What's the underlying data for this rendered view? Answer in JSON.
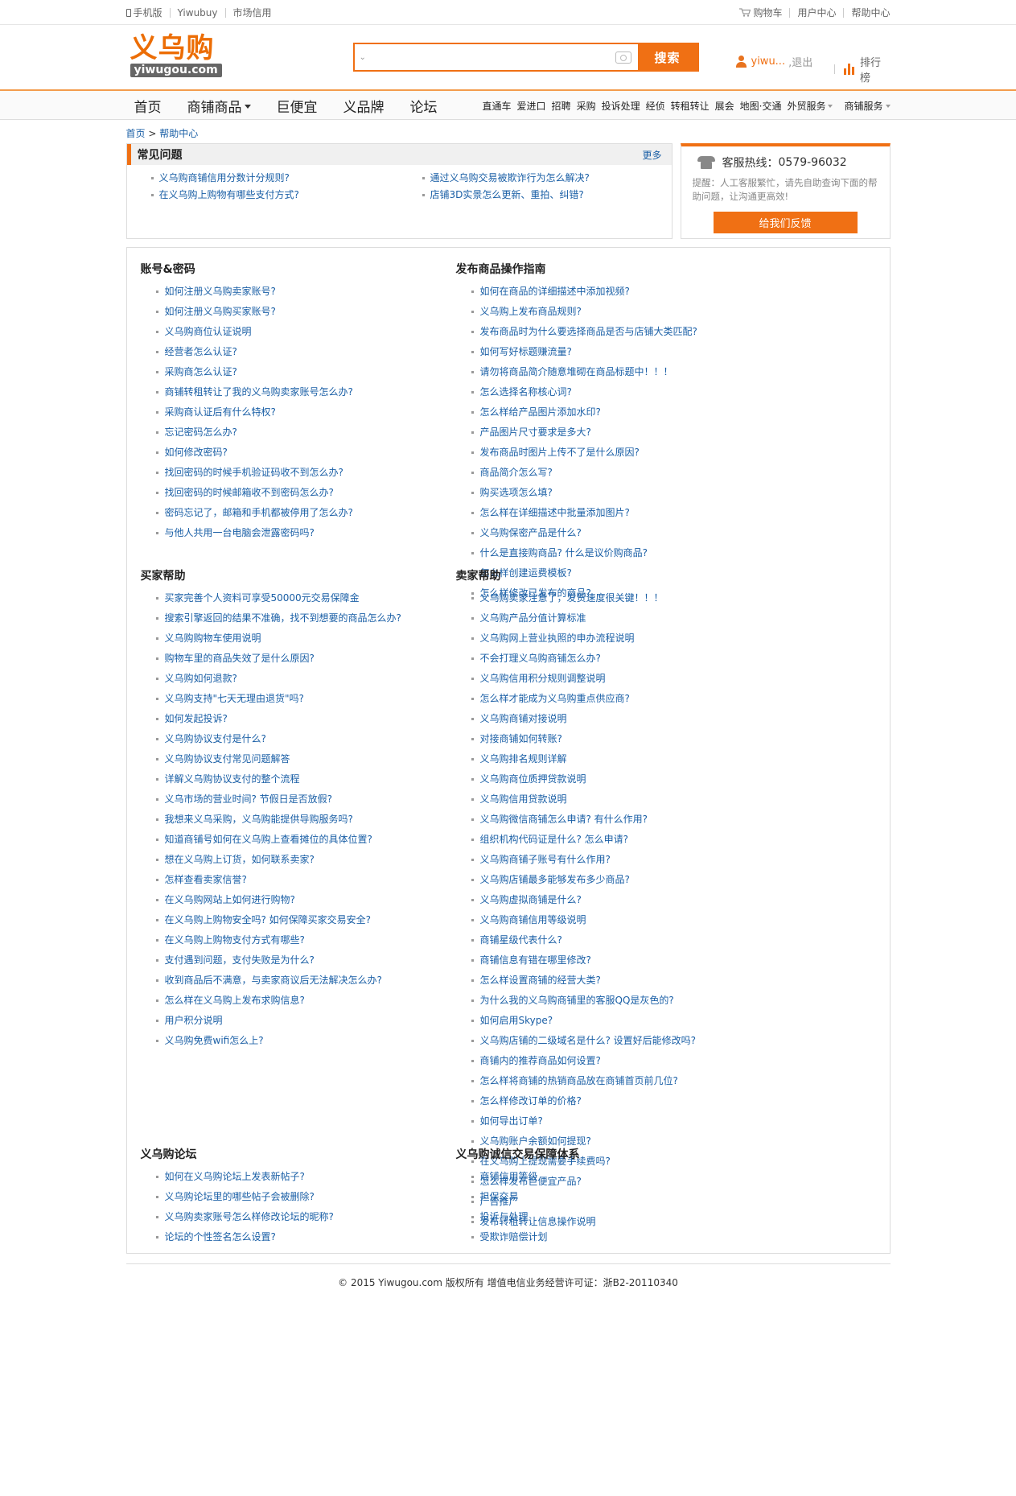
{
  "topbar": {
    "left": [
      "手机版",
      "Yiwubuy",
      "市场信用"
    ],
    "right": [
      "购物车",
      "用户中心",
      "帮助中心"
    ]
  },
  "logo": {
    "cn": "义乌购",
    "en": "yiwugou.com"
  },
  "search": {
    "button": "搜索",
    "placeholder": ""
  },
  "user": {
    "name": "yiwu...",
    "logout": "退出",
    "rank": "排行榜"
  },
  "nav": {
    "main": [
      "首页",
      "商铺商品",
      "巨便宜",
      "义品牌",
      "论坛"
    ],
    "sub": [
      "直通车",
      "爱进口",
      "招聘",
      "采购",
      "投诉处理",
      "经侦",
      "转租转让",
      "展会",
      "地图·交通",
      "外贸服务",
      "商铺服务"
    ]
  },
  "breadcrumb": {
    "home": "首页",
    "sep": ">",
    "current": "帮助中心"
  },
  "faq": {
    "title": "常见问题",
    "more": "更多",
    "items": [
      "义乌购商铺信用分数计分规则?",
      "通过义乌购交易被欺诈行为怎么解决?",
      "在义乌购上购物有哪些支付方式?",
      "店铺3D实景怎么更新、重拍、纠错?"
    ]
  },
  "hotline": {
    "label": "客服热线：",
    "number": "0579-96032",
    "tip": "提醒：人工客服繁忙，请先自助查询下面的帮助问题，让沟通更高效!",
    "feedback": "给我们反馈"
  },
  "sections": {
    "account": {
      "title": "账号&密码",
      "items": [
        "如何注册义乌购卖家账号?",
        "如何注册义乌购买家账号?",
        "义乌购商位认证说明",
        "经营者怎么认证?",
        "采购商怎么认证?",
        "商铺转租转让了我的义乌购卖家账号怎么办?",
        "采购商认证后有什么特权?",
        "忘记密码怎么办?",
        "如何修改密码?",
        "找回密码的时候手机验证码收不到怎么办?",
        "找回密码的时候邮箱收不到密码怎么办?",
        "密码忘记了，邮箱和手机都被停用了怎么办?",
        "与他人共用一台电脑会泄露密码吗?"
      ]
    },
    "publish": {
      "title": "发布商品操作指南",
      "items": [
        "如何在商品的详细描述中添加视频?",
        "义乌购上发布商品规则?",
        "发布商品时为什么要选择商品是否与店铺大类匹配?",
        "如何写好标题赚流量?",
        "请勿将商品简介随意堆砌在商品标题中！！！",
        "怎么选择名称核心词?",
        "怎么样给产品图片添加水印?",
        "产品图片尺寸要求是多大?",
        "发布商品时图片上传不了是什么原因?",
        "商品简介怎么写?",
        "购买选项怎么填?",
        "怎么样在详细描述中批量添加图片?",
        "义乌购保密产品是什么?",
        "什么是直接购商品? 什么是议价购商品?",
        "怎么样创建运费模板?",
        "怎么样修改已发布的商品?"
      ]
    },
    "buyer": {
      "title": "买家帮助",
      "items": [
        "买家完善个人资料可享受50000元交易保障金",
        "搜索引擎返回的结果不准确，找不到想要的商品怎么办?",
        "义乌购购物车使用说明",
        "购物车里的商品失效了是什么原因?",
        "义乌购如何退款?",
        "义乌购支持\"七天无理由退货\"吗?",
        "如何发起投诉?",
        "义乌购协议支付是什么?",
        "义乌购协议支付常见问题解答",
        "详解义乌购协议支付的整个流程",
        "义乌市场的营业时间? 节假日是否放假?",
        "我想来义乌采购，义乌购能提供导购服务吗?",
        "知道商铺号如何在义乌购上查看摊位的具体位置?",
        "想在义乌购上订货，如何联系卖家?",
        "怎样查看卖家信誉?",
        "在义乌购网站上如何进行购物?",
        "在义乌购上购物安全吗? 如何保障买家交易安全?",
        "在义乌购上购物支付方式有哪些?",
        "支付遇到问题，支付失败是为什么?",
        "收到商品后不满意，与卖家商议后无法解决怎么办?",
        "怎么样在义乌购上发布求购信息?",
        "用户积分说明",
        "义乌购免费wifi怎么上?"
      ]
    },
    "seller": {
      "title": "卖家帮助",
      "items": [
        "义乌购卖家注意了，发货速度很关键！！！",
        "义乌购产品分值计算标准",
        "义乌购网上营业执照的申办流程说明",
        "不会打理义乌购商铺怎么办?",
        "义乌购信用积分规则调整说明",
        "怎么样才能成为义乌购重点供应商?",
        "义乌购商铺对接说明",
        "对接商铺如何转账?",
        "义乌购排名规则详解",
        "义乌购商位质押贷款说明",
        "义乌购信用贷款说明",
        "义乌购微信商铺怎么申请? 有什么作用?",
        "组织机构代码证是什么? 怎么申请?",
        "义乌购商铺子账号有什么作用?",
        "义乌购店铺最多能够发布多少商品?",
        "义乌购虚拟商铺是什么?",
        "义乌购商铺信用等级说明",
        "商铺星级代表什么?",
        "商铺信息有错在哪里修改?",
        "怎么样设置商铺的经营大类?",
        "为什么我的义乌购商铺里的客服QQ是灰色的?",
        "如何启用Skype?",
        "义乌购店铺的二级域名是什么? 设置好后能修改吗?",
        "商铺内的推荐商品如何设置?",
        "怎么样将商铺的热销商品放在商铺首页前几位?",
        "怎么样修改订单的价格?",
        "如何导出订单?",
        "义乌购账户余额如何提现?",
        "在义乌购上提现需要手续费吗?",
        "怎么样发布巨便宜产品?",
        "广告推广",
        "发布转租转让信息操作说明"
      ]
    },
    "forum": {
      "title": "义乌购论坛",
      "items": [
        "如何在义乌购论坛上发表新帖子?",
        "义乌购论坛里的哪些帖子会被删除?",
        "义乌购卖家账号怎么样修改论坛的昵称?",
        "论坛的个性签名怎么设置?"
      ]
    },
    "integrity": {
      "title": "义乌购诚信交易保障体系",
      "items": [
        "商铺信用等级",
        "担保交易",
        "投诉与处理",
        "受欺诈赔偿计划"
      ]
    }
  },
  "footer": {
    "text": "© 2015 Yiwugou.com 版权所有 增值电信业务经营许可证：浙B2-20110340"
  },
  "colors": {
    "accent": "#f07014",
    "link": "#1a5fa6"
  }
}
